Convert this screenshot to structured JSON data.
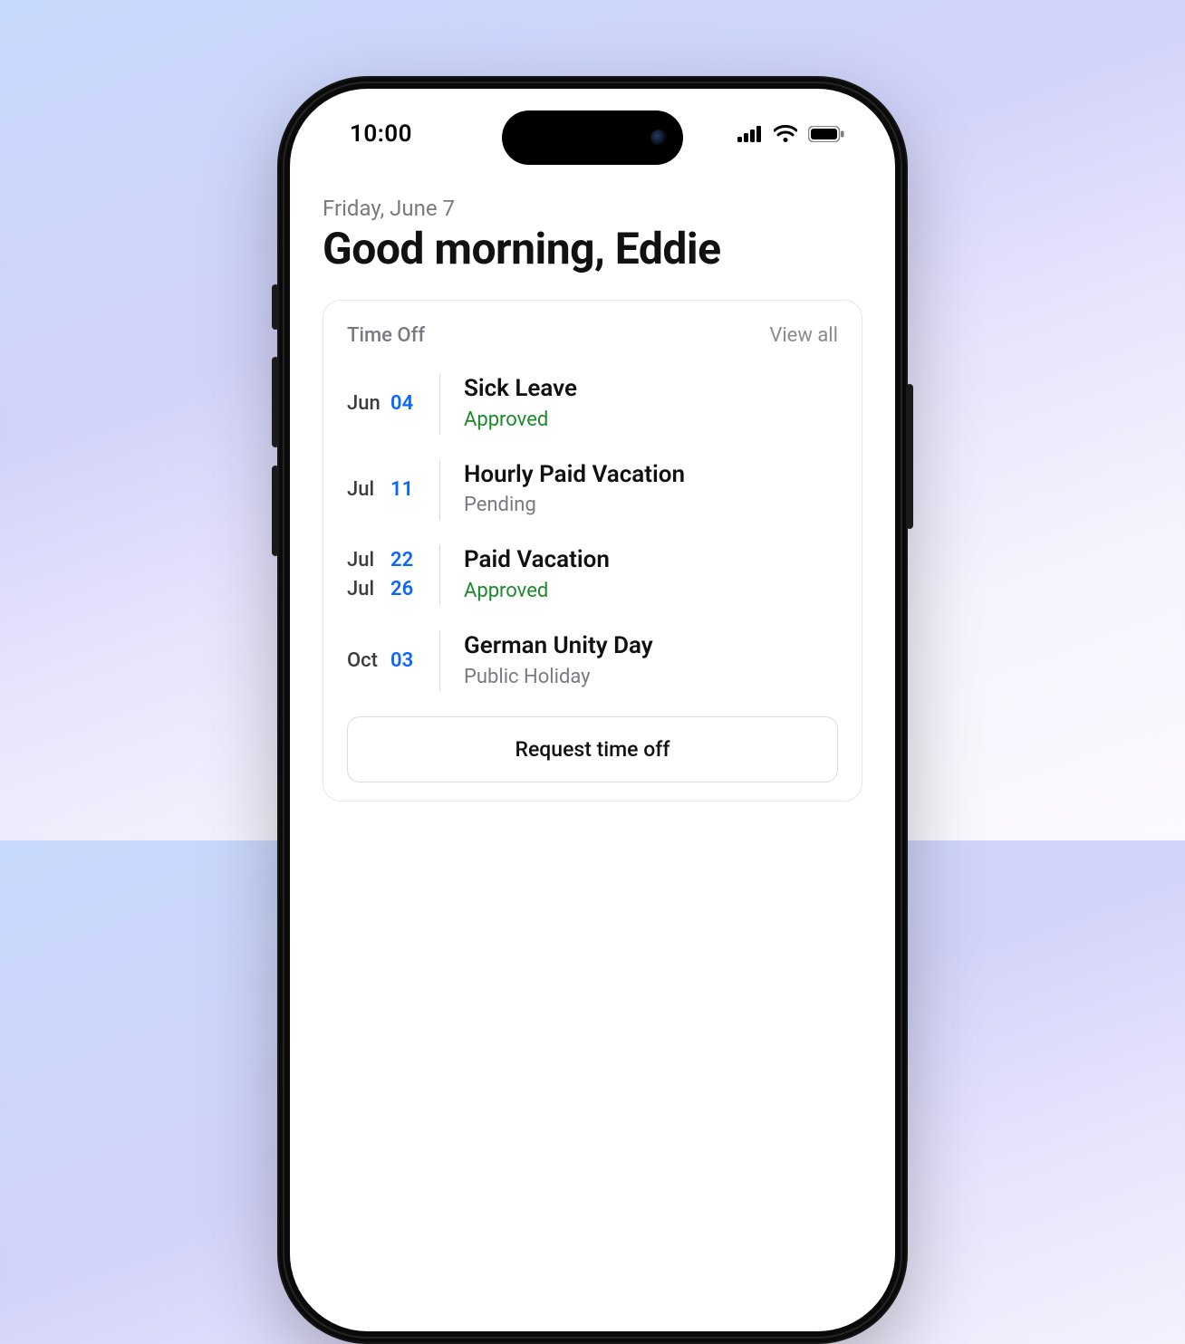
{
  "status_bar": {
    "time": "10:00"
  },
  "header": {
    "date": "Friday, June 7",
    "greeting": "Good morning, Eddie"
  },
  "time_off_card": {
    "title": "Time Off",
    "view_all": "View all",
    "request_button": "Request time off",
    "items": [
      {
        "dates": [
          {
            "month": "Jun",
            "day": "04"
          }
        ],
        "title": "Sick Leave",
        "status": "Approved",
        "status_kind": "approved"
      },
      {
        "dates": [
          {
            "month": "Jul",
            "day": "11"
          }
        ],
        "title": "Hourly Paid Vacation",
        "status": "Pending",
        "status_kind": "pending"
      },
      {
        "dates": [
          {
            "month": "Jul",
            "day": "22"
          },
          {
            "month": "Jul",
            "day": "26"
          }
        ],
        "title": "Paid Vacation",
        "status": "Approved",
        "status_kind": "approved"
      },
      {
        "dates": [
          {
            "month": "Oct",
            "day": "03"
          }
        ],
        "title": "German Unity Day",
        "status": "Public Holiday",
        "status_kind": "holiday"
      }
    ]
  }
}
